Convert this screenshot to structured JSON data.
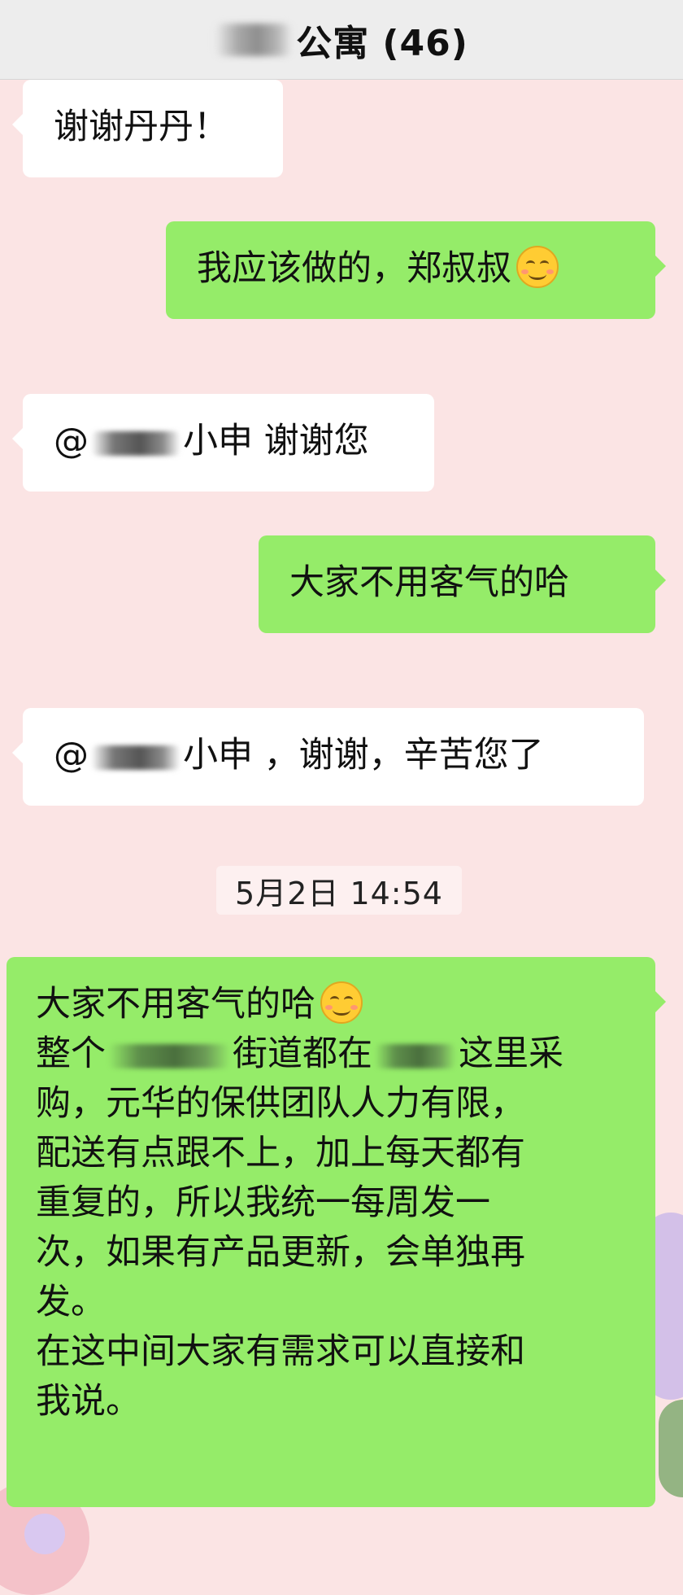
{
  "header": {
    "title": "公寓 (46)"
  },
  "messages": {
    "m1": {
      "text": "谢谢丹丹！"
    },
    "m2": {
      "text": "我应该做的，郑叔叔"
    },
    "m3": {
      "prefix": "@",
      "suffix": "小申 谢谢您"
    },
    "m4": {
      "text": "大家不用客气的哈"
    },
    "m5": {
      "prefix": "@",
      "suffix": "小申 ，谢谢，辛苦您了"
    },
    "m6": {
      "line1": "大家不用客气的哈",
      "line2_a": "整个",
      "line2_b": "街道都在",
      "line2_c": "这里采",
      "line3": "购，元华的保供团队人力有限，",
      "line4": "配送有点跟不上，加上每天都有",
      "line5": "重复的，所以我统一每周发一",
      "line6": "次，如果有产品更新，会单独再",
      "line7": "发。",
      "line8": "在这中间大家有需求可以直接和",
      "line9": "我说。"
    }
  },
  "timestamp": "5月2日 14:54",
  "icons": {
    "emoji": "smiling-face-icon"
  },
  "colors": {
    "outgoing": "#95ec69",
    "incoming": "#ffffff",
    "background": "#fbe4e4"
  }
}
